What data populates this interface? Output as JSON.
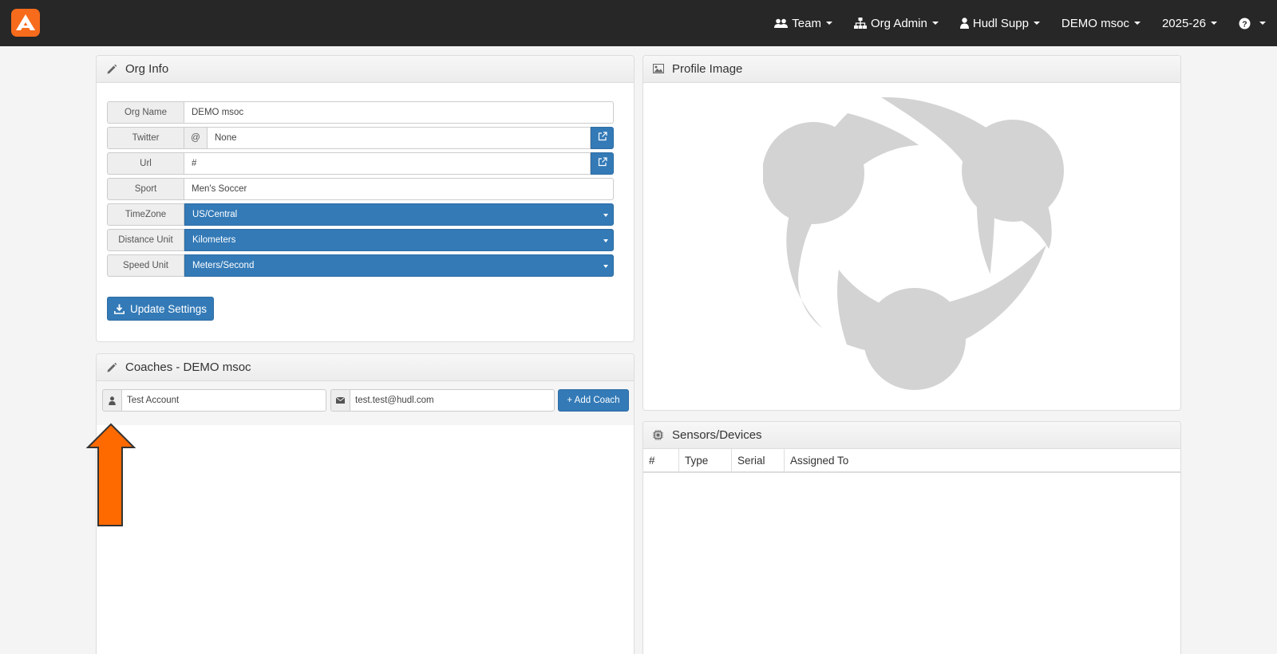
{
  "nav": {
    "items": [
      {
        "label": "Team",
        "icon": "users-icon"
      },
      {
        "label": "Org Admin",
        "icon": "sitemap-icon"
      },
      {
        "label": "Hudl Supp",
        "icon": "user-icon"
      },
      {
        "label": "DEMO msoc",
        "icon": ""
      },
      {
        "label": "2025-26",
        "icon": ""
      },
      {
        "label": "",
        "icon": "help-icon"
      }
    ]
  },
  "org_info": {
    "title": "Org Info",
    "org_name_label": "Org Name",
    "org_name_value": "DEMO msoc",
    "twitter_label": "Twitter",
    "twitter_prefix": "@",
    "twitter_value": "None",
    "url_label": "Url",
    "url_value": "#",
    "sport_label": "Sport",
    "sport_value": "Men's Soccer",
    "timezone_label": "TimeZone",
    "timezone_value": "US/Central",
    "distance_label": "Distance Unit",
    "distance_value": "Kilometers",
    "speed_label": "Speed Unit",
    "speed_value": "Meters/Second",
    "update_button": "Update Settings"
  },
  "coaches": {
    "title": "Coaches - DEMO msoc",
    "name_value": "Test Account",
    "email_value": "test.test@hudl.com",
    "add_button": "+ Add Coach"
  },
  "profile_image": {
    "title": "Profile Image"
  },
  "sensors": {
    "title": "Sensors/Devices",
    "columns": [
      "#",
      "Type",
      "Serial",
      "Assigned To"
    ]
  },
  "colors": {
    "brand": "#f76b1c",
    "primary": "#337ab7",
    "navbar": "#272727",
    "arrow": "#ff6a00"
  }
}
